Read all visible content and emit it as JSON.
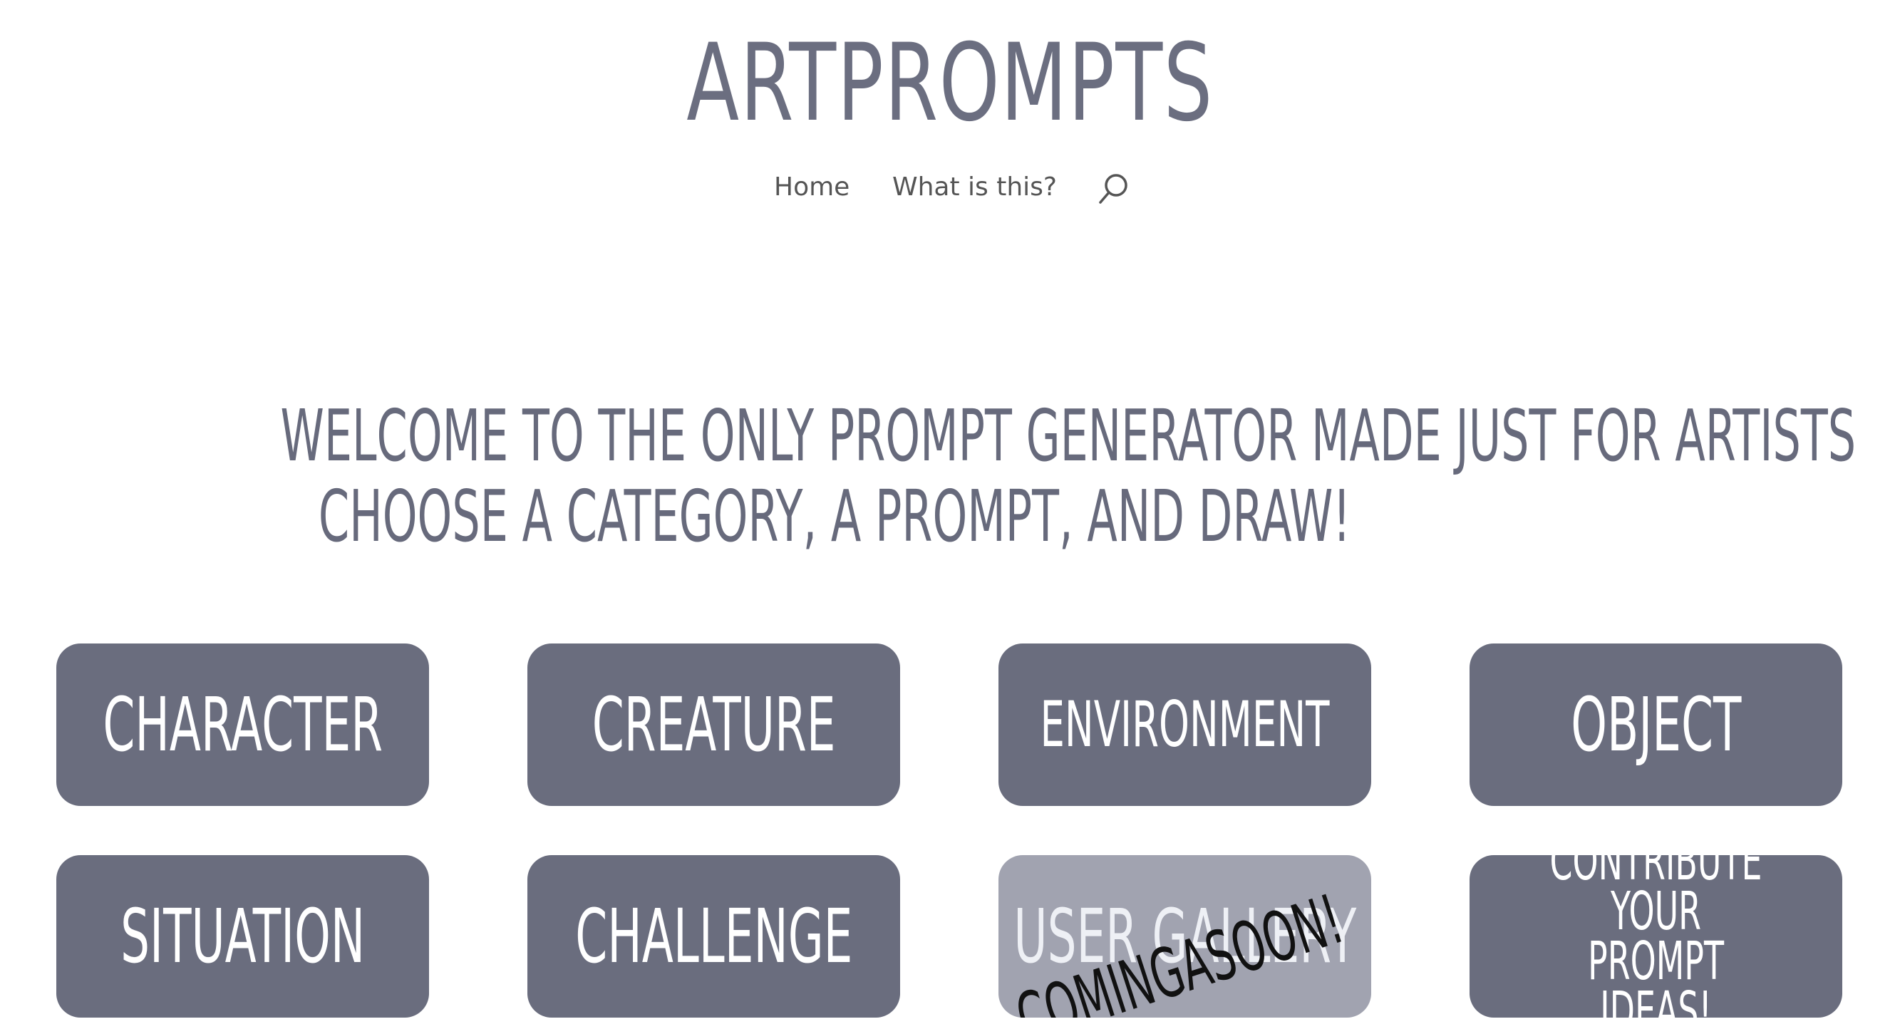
{
  "site": {
    "logo": "ARTPROMPTS"
  },
  "nav": {
    "home": "Home",
    "what_is_this": "What is this?",
    "search_icon": "search-icon"
  },
  "welcome": {
    "line1": "WELCOME TO THE ONLY PROMPT GENERATOR MADE JUST FOR ARTISTS",
    "line2": "CHOOSE A CATEGORY, A PROMPT, AND DRAW!"
  },
  "categories": [
    {
      "label": "CHARACTER"
    },
    {
      "label": "CREATURE"
    },
    {
      "label": "ENVIRONMENT"
    },
    {
      "label": "OBJECT"
    },
    {
      "label": "SITUATION"
    },
    {
      "label": "CHALLENGE"
    },
    {
      "label": "USER GALLERY",
      "overlay": "COMINGASOON!"
    },
    {
      "label": "CONTRIBUTE YOUR PROMPT IDEAS!"
    }
  ],
  "colors": {
    "card": "#6a6d7e",
    "card_disabled": "#a1a3b0",
    "text": "#676a7c"
  }
}
